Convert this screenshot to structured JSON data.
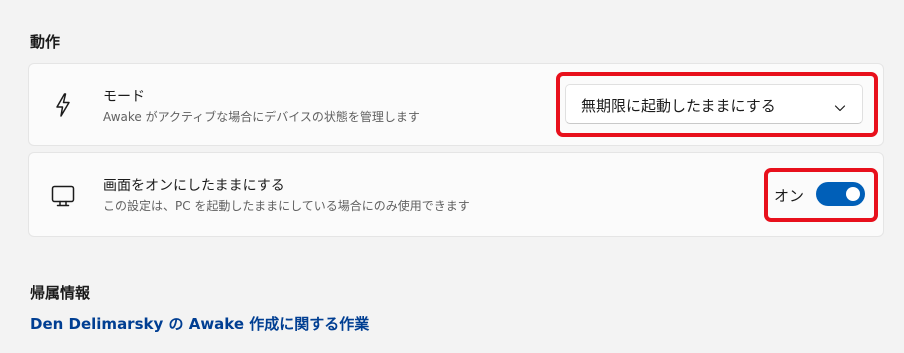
{
  "behavior": {
    "section_title": "動作",
    "mode": {
      "icon": "lightning-icon",
      "title": "モード",
      "description": "Awake がアクティブな場合にデバイスの状態を管理します",
      "selected_option": "無期限に起動したままにする",
      "chevron_icon": "chevron-down-icon"
    },
    "keep_screen_on": {
      "icon": "monitor-icon",
      "title": "画面をオンにしたままにする",
      "description": "この設定は、PC を起動したままにしている場合にのみ使用できます",
      "toggle_label": "オン",
      "toggle_on": true
    }
  },
  "attribution": {
    "section_title": "帰属情報",
    "link_text": "Den Delimarsky の Awake 作成に関する作業"
  },
  "colors": {
    "accent": "#005fb8",
    "link": "#003e92",
    "highlight": "#e8101c"
  }
}
